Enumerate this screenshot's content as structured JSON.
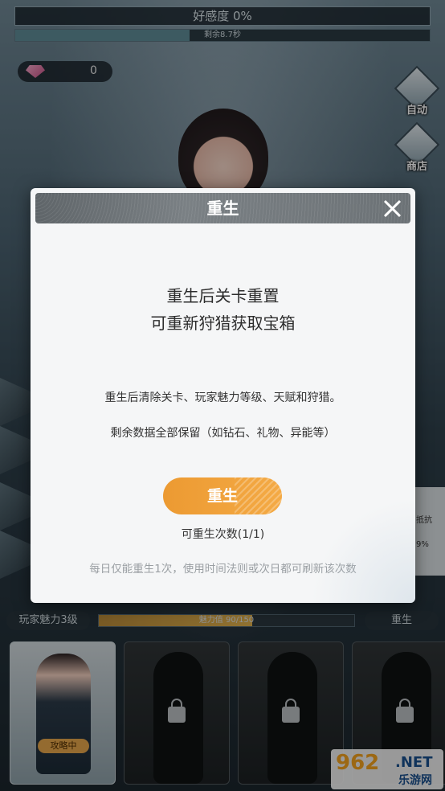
{
  "hud": {
    "affection_label": "好感度 0%",
    "timer_label": "剩余8.7秒",
    "gem_count": "0"
  },
  "side_menu": [
    {
      "label": "自动",
      "icon": "robot-icon"
    },
    {
      "label": "商店",
      "icon": "shop-icon"
    }
  ],
  "right_panel": {
    "label_a": "抵抗",
    "label_b": "9%"
  },
  "charm": {
    "level_label": "玩家魅力3级",
    "progress_label": "魅力值 90/150",
    "progress_fraction": 0.6,
    "rebirth_label": "重生"
  },
  "characters": [
    {
      "status": "攻略中",
      "locked": false
    },
    {
      "status": "",
      "locked": true
    },
    {
      "status": "",
      "locked": true
    },
    {
      "status": "",
      "locked": true
    }
  ],
  "modal": {
    "title": "重生",
    "headline_1": "重生后关卡重置",
    "headline_2": "可重新狩猎获取宝箱",
    "desc_1": "重生后清除关卡、玩家魅力等级、天赋和狩猎。",
    "desc_2": "剩余数据全部保留（如钻石、礼物、异能等）",
    "button_label": "重生",
    "count_label": "可重生次数(1/1)",
    "note": "每日仅能重生1次，使用时间法则或次日都可刷新该次数"
  },
  "watermark": {
    "brand": "962",
    "suffix": ".NET",
    "site": "乐游网"
  },
  "colors": {
    "accent_orange": "#f0a03a",
    "modal_bg": "#f5f6f7",
    "header_gray": "#6c7276"
  }
}
